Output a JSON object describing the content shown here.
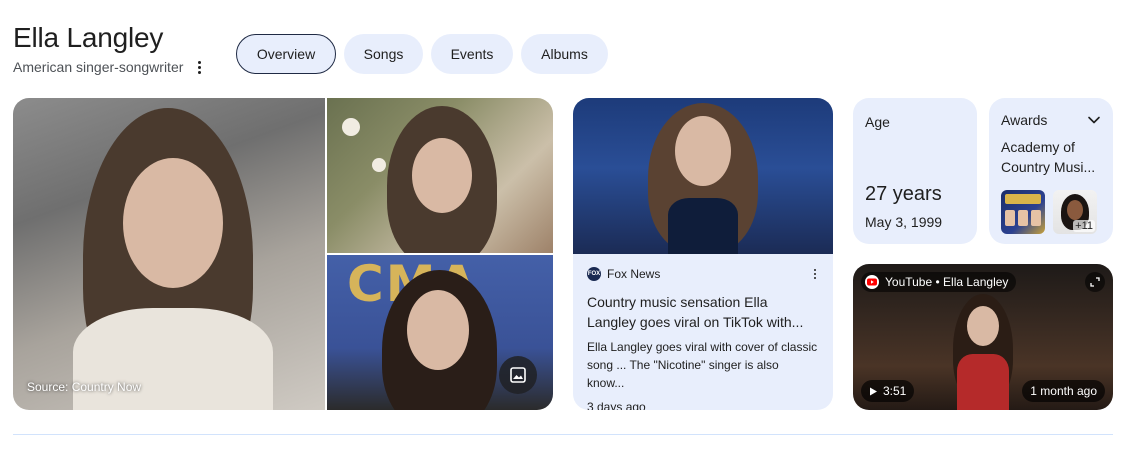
{
  "entity": {
    "name": "Ella Langley",
    "description": "American singer-songwriter"
  },
  "tabs": [
    {
      "label": "Overview",
      "active": true
    },
    {
      "label": "Songs",
      "active": false
    },
    {
      "label": "Events",
      "active": false
    },
    {
      "label": "Albums",
      "active": false
    }
  ],
  "images": {
    "main_source": "Source: Country Now",
    "cma_text": "CMA",
    "more_images_icon": "image-icon"
  },
  "news": {
    "source": "Fox News",
    "headline": "Country music sensation Ella Langley goes viral on TikTok with...",
    "snippet": "Ella Langley goes viral with cover of classic song ... The \"Nicotine\" singer is also know...",
    "time": "3 days ago"
  },
  "age_card": {
    "label": "Age",
    "value": "27 years",
    "birth_date": "May 3, 1999"
  },
  "awards_card": {
    "label": "Awards",
    "text": "Academy of Country Musi...",
    "more_count": "+11"
  },
  "video": {
    "source": "YouTube • Ella Langley",
    "duration": "3:51",
    "age": "1 month ago"
  },
  "colors": {
    "card_bg": "#e8eefc",
    "tab_active_border": "#1f2a44",
    "text": "#1f1f1f",
    "secondary_text": "#4d5156",
    "youtube_red": "#ff0000"
  }
}
